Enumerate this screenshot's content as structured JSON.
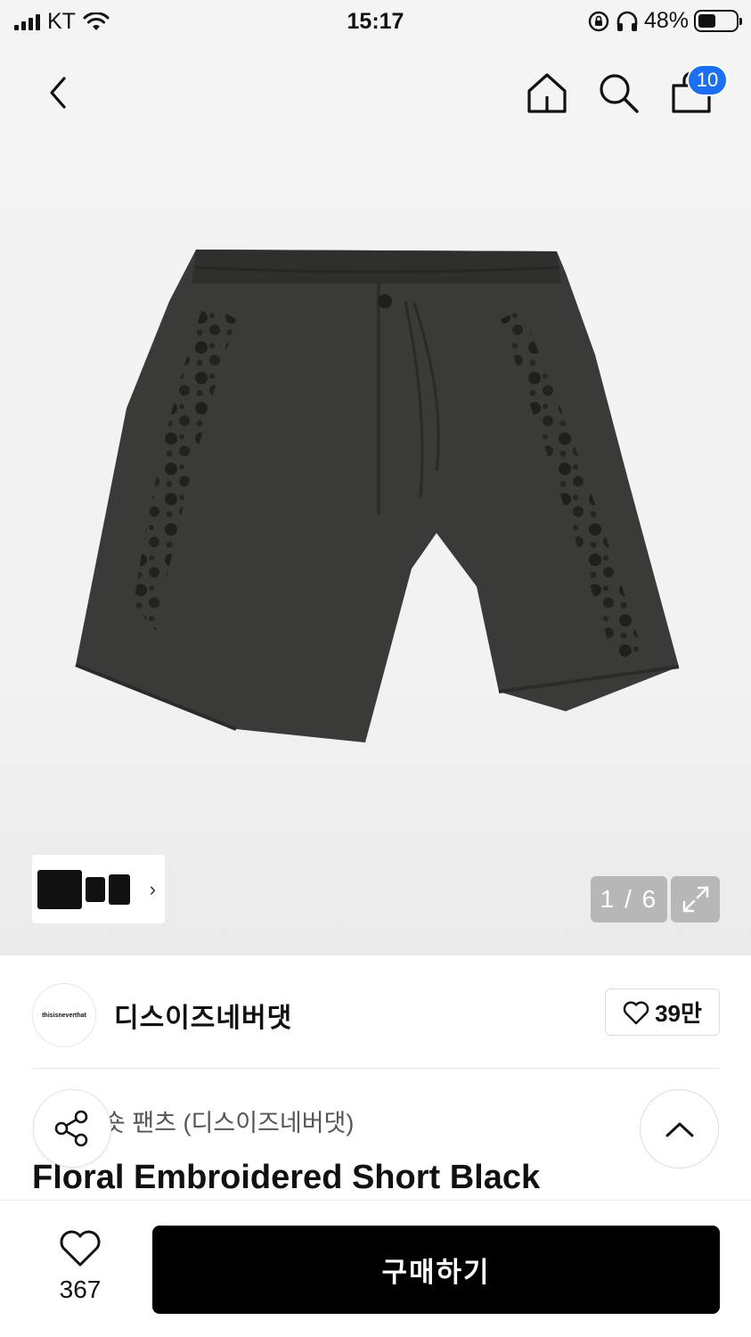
{
  "status_bar": {
    "carrier": "KT",
    "time": "15:17",
    "battery": "48%",
    "battery_level": 0.48
  },
  "nav": {
    "cart_badge": "10",
    "icons": [
      "back-icon",
      "home-icon",
      "search-icon",
      "shopping-bag-icon"
    ]
  },
  "gallery": {
    "counter": "1 / 6",
    "logo_text": "thisisneverthat"
  },
  "brand": {
    "logo_text": "thisisneverthat",
    "name": "디스이즈네버댓",
    "likes": "39만"
  },
  "product": {
    "korean_name": "숏 팬츠 (디스이즈네버댓)",
    "english_name": "Floral Embroidered Short Black"
  },
  "bottom_bar": {
    "wish_count": "367",
    "buy_label": "구매하기"
  },
  "colors": {
    "accent": "#1c6ef3",
    "buy_button": "#000000",
    "product": "#3a3a38"
  }
}
